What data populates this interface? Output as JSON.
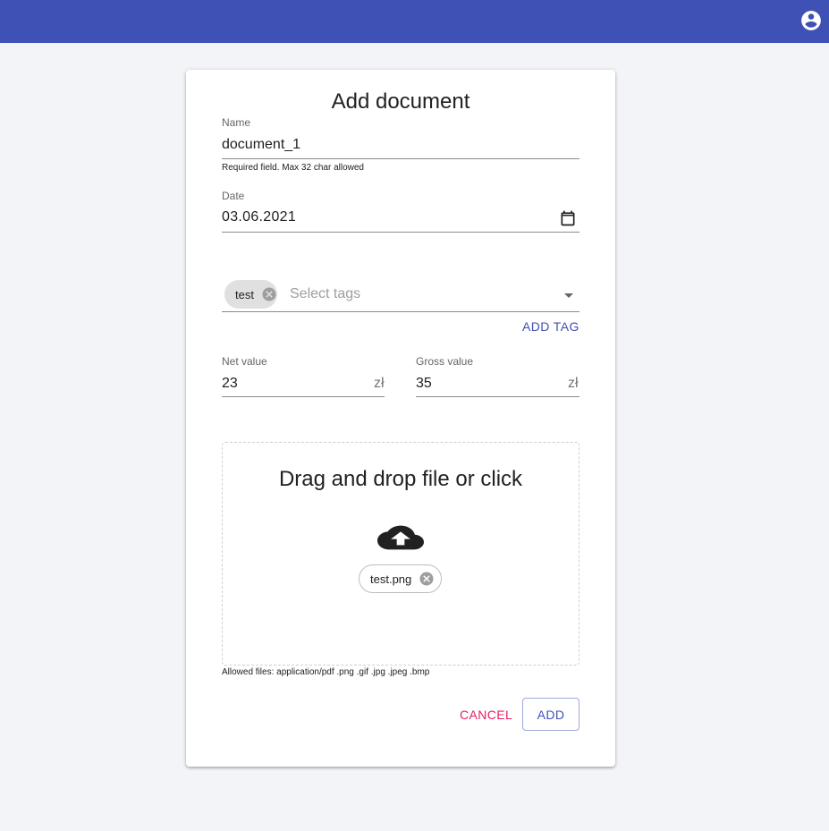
{
  "appbar": {
    "account_icon": "account-circle-icon",
    "color": "#3f51b5"
  },
  "dialog": {
    "title": "Add document",
    "name": {
      "label": "Name",
      "value": "document_1",
      "helper": "Required field. Max 32 char allowed"
    },
    "date": {
      "label": "Date",
      "value": "03.06.2021",
      "icon": "calendar-icon"
    },
    "tags": {
      "chips": [
        "test"
      ],
      "placeholder": "Select tags",
      "add_label": "ADD TAG"
    },
    "net": {
      "label": "Net value",
      "value": "23",
      "unit": "zł"
    },
    "gross": {
      "label": "Gross value",
      "value": "35",
      "unit": "zł"
    },
    "upload": {
      "title": "Drag and drop file or click",
      "icon": "cloud-upload-icon",
      "file": "test.png",
      "allowed": "Allowed files: application/pdf .png .gif .jpg .jpeg .bmp"
    },
    "actions": {
      "cancel": "CANCEL",
      "add": "ADD"
    }
  },
  "colors": {
    "primary": "#3f51b5",
    "secondary": "#e91e63"
  }
}
